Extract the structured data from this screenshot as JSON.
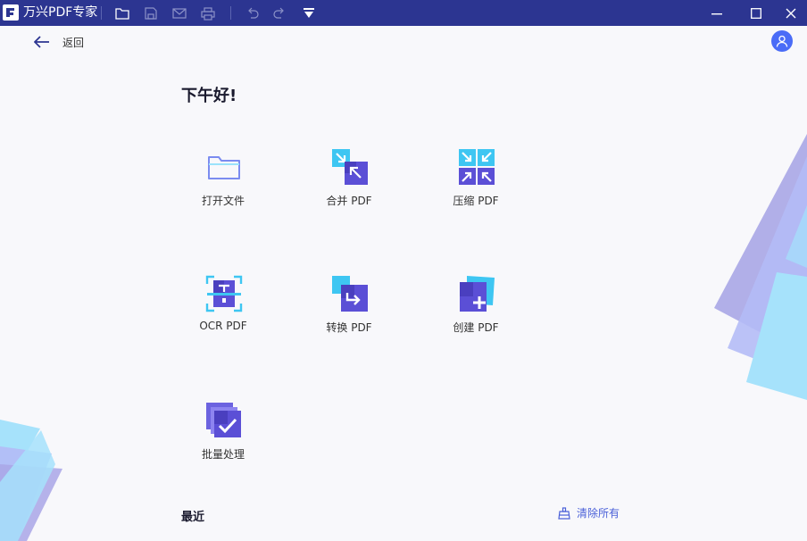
{
  "titlebar": {
    "app_title": "万兴PDF专家",
    "logo_icon": "wondershare-pdfelement-logo",
    "toolbar_icons": [
      "open-folder-icon",
      "save-icon",
      "email-icon",
      "print-icon",
      "undo-icon",
      "redo-icon",
      "quick-access-dropdown-icon"
    ],
    "window_controls": [
      "minimize-icon",
      "maximize-icon",
      "close-icon"
    ]
  },
  "nav": {
    "back_label": "返回",
    "back_icon": "arrow-left-icon"
  },
  "user": {
    "avatar_icon": "user-icon"
  },
  "greeting": "下午好!",
  "tools": [
    {
      "label": "打开文件",
      "icon": "folder-icon"
    },
    {
      "label": "合并 PDF",
      "icon": "merge-pdf-icon"
    },
    {
      "label": "压缩 PDF",
      "icon": "compress-pdf-icon"
    },
    {
      "label": "OCR PDF",
      "icon": "ocr-pdf-icon"
    },
    {
      "label": "转换 PDF",
      "icon": "convert-pdf-icon"
    },
    {
      "label": "创建 PDF",
      "icon": "create-pdf-icon"
    },
    {
      "label": "批量处理",
      "icon": "batch-process-icon"
    }
  ],
  "recent": {
    "title": "最近",
    "clear_label": "清除所有",
    "clear_icon": "broom-icon"
  },
  "colors": {
    "titlebar": "#2c3591",
    "accent": "#4a6cf7",
    "icon_purple": "#5b4fd6",
    "icon_cyan": "#3ec6f2",
    "deco_lavender": "#a9a6e6",
    "deco_light_blue": "#a6e2fb"
  }
}
